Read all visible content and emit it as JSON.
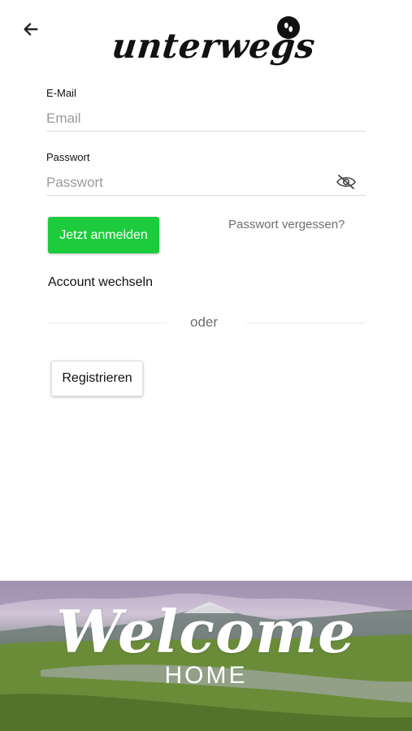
{
  "header": {
    "logo_text": "unterwegs"
  },
  "form": {
    "email": {
      "label": "E-Mail",
      "placeholder": "Email",
      "value": ""
    },
    "password": {
      "label": "Passwort",
      "placeholder": "Passwort",
      "value": ""
    },
    "login_label": "Jetzt anmelden",
    "forgot_label": "Passwort vergessen?",
    "switch_account_label": "Account wechseln",
    "divider_label": "oder",
    "register_label": "Registrieren"
  },
  "banner": {
    "title": "Welcome",
    "subtitle": "HOME"
  },
  "colors": {
    "primary_button": "#1ccc3c",
    "muted_text": "#6e6e6e"
  },
  "icons": {
    "back": "back-arrow-icon",
    "logo_badge": "footprints-icon",
    "password_visibility": "eye-slash-icon"
  }
}
